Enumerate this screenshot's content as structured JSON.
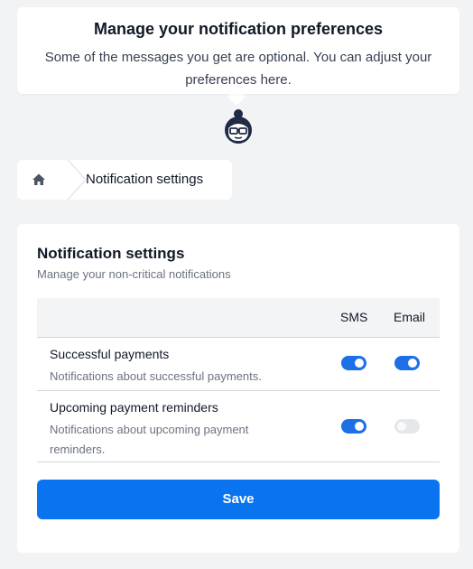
{
  "tooltip": {
    "title": "Manage your notification preferences",
    "description": "Some of the messages you get are optional. You can adjust your preferences here."
  },
  "breadcrumb": {
    "home_icon": "home-icon",
    "current": "Notification settings"
  },
  "settings": {
    "title": "Notification settings",
    "subtitle": "Manage your non-critical notifications",
    "columns": {
      "sms": "SMS",
      "email": "Email"
    },
    "rows": [
      {
        "title": "Successful payments",
        "description": "Notifications about successful payments.",
        "sms_enabled": true,
        "email_enabled": true
      },
      {
        "title": "Upcoming payment reminders",
        "description": "Notifications about upcoming payment reminders.",
        "sms_enabled": true,
        "email_enabled": false
      }
    ],
    "save_label": "Save"
  },
  "colors": {
    "accent": "#0a74f0",
    "toggle_on": "#1d6fe8",
    "toggle_off": "#e5e7eb",
    "background": "#f2f3f5"
  }
}
